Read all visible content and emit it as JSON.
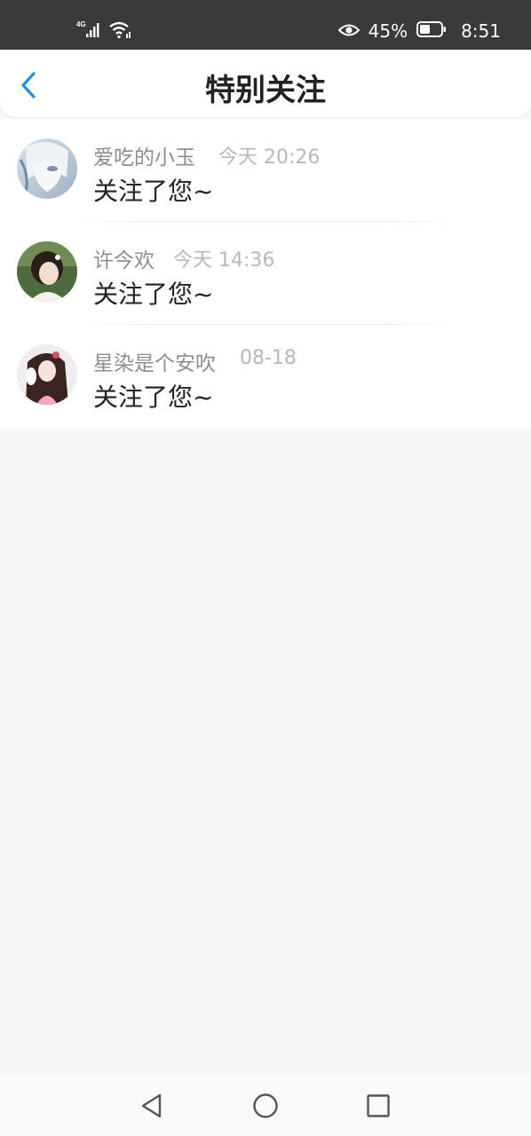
{
  "status_bar": {
    "network": "4G",
    "battery": "45%",
    "time": "8:51",
    "icons": [
      "signal-icon",
      "wifi-icon",
      "eye-icon",
      "battery-icon"
    ]
  },
  "header": {
    "title": "特别关注",
    "back_icon": "chevron-left-icon",
    "accent": "#2a8ee0"
  },
  "notifications": [
    {
      "name": "爱吃的小玉",
      "time": "今天 20:26",
      "message": "关注了您~"
    },
    {
      "name": "许今欢",
      "time": "今天 14:36",
      "message": "关注了您~"
    },
    {
      "name": "星染是个安吹",
      "time": "08-18",
      "message": "关注了您~"
    }
  ],
  "nav_bar": {
    "icons": [
      "nav-back-icon",
      "nav-home-icon",
      "nav-recents-icon"
    ]
  }
}
